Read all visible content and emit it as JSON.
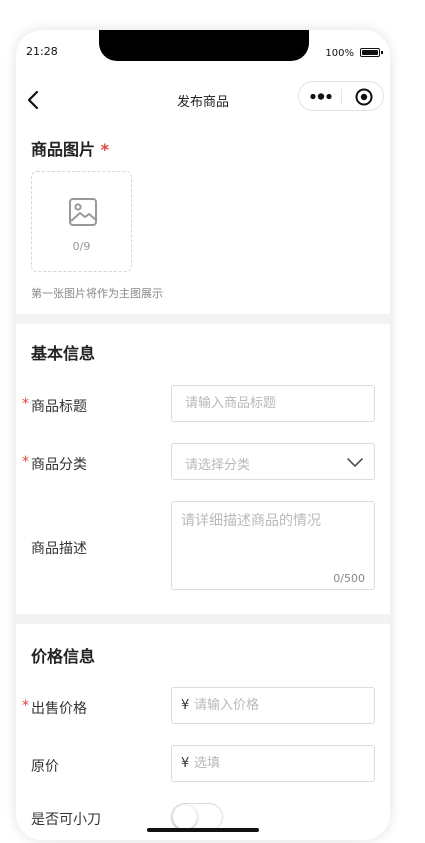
{
  "status_bar": {
    "time": "21:28",
    "battery": "100%"
  },
  "nav": {
    "title": "发布商品"
  },
  "images": {
    "title": "商品图片",
    "required_mark": "*",
    "count": "0/9",
    "hint": "第一张图片将作为主图展示"
  },
  "basic": {
    "title": "基本信息",
    "product_title": {
      "label": "商品标题",
      "required": "*",
      "placeholder": "请输入商品标题"
    },
    "category": {
      "label": "商品分类",
      "required": "*",
      "placeholder": "请选择分类"
    },
    "description": {
      "label": "商品描述",
      "placeholder": "请详细描述商品的情况",
      "counter": "0/500"
    }
  },
  "price": {
    "title": "价格信息",
    "sale_price": {
      "label": "出售价格",
      "required": "*",
      "currency": "¥",
      "placeholder": "请输入价格"
    },
    "original_price": {
      "label": "原价",
      "currency": "¥",
      "placeholder": "选填"
    },
    "bargain": {
      "label": "是否可小刀",
      "value": false
    }
  },
  "colors": {
    "required": "#e2423c",
    "border": "#dcdcdc",
    "background": "#f3f3f3"
  },
  "icons": [
    "back-icon",
    "more-dots-icon",
    "close-target-icon",
    "image-icon",
    "chevron-down-icon"
  ]
}
